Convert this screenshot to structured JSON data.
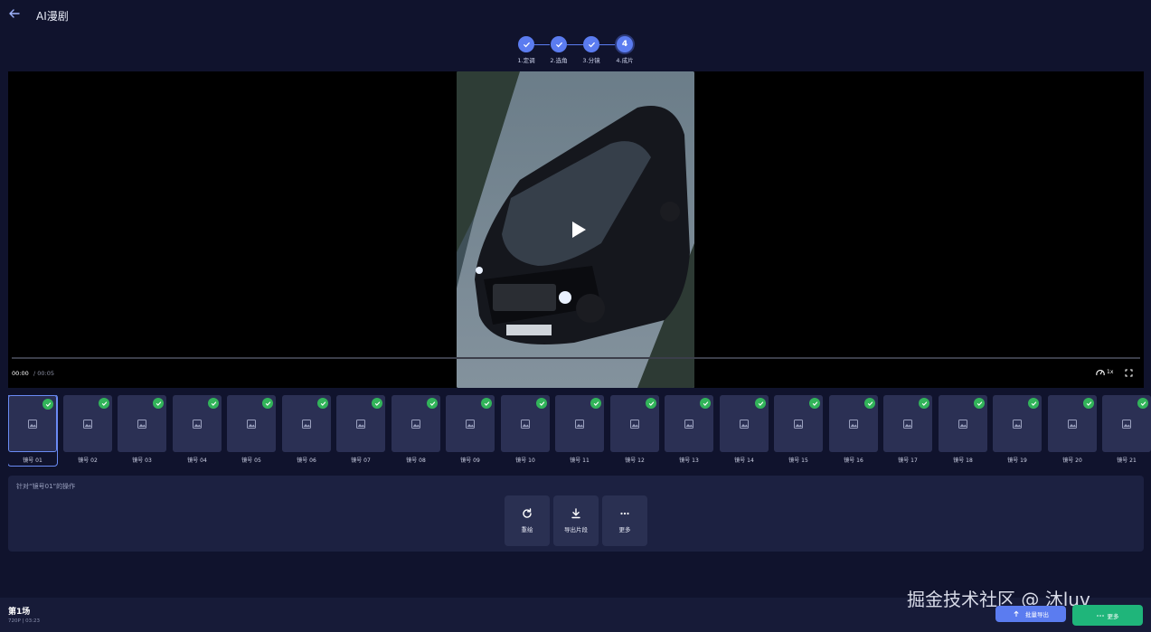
{
  "header": {
    "title": "AI漫剧"
  },
  "stepper": {
    "steps": [
      {
        "label": "1.定调",
        "state": "done"
      },
      {
        "label": "2.选角",
        "state": "done"
      },
      {
        "label": "3.分镜",
        "state": "done"
      },
      {
        "label": "4.成片",
        "state": "current",
        "number": "4"
      }
    ]
  },
  "player": {
    "current_time": "00:00",
    "total_time": "/ 00:05",
    "speed": "1x",
    "progress": 0
  },
  "shots": {
    "selected_index": 0,
    "items": [
      "镜号 01",
      "镜号 02",
      "镜号 03",
      "镜号 04",
      "镜号 05",
      "镜号 06",
      "镜号 07",
      "镜号 08",
      "镜号 09",
      "镜号 10",
      "镜号 11",
      "镜号 12",
      "镜号 13",
      "镜号 14",
      "镜号 15",
      "镜号 16",
      "镜号 17",
      "镜号 18",
      "镜号 19",
      "镜号 20",
      "镜号 21"
    ]
  },
  "ops_panel": {
    "title": "针对“镜号01”的操作",
    "buttons": [
      {
        "label": "重绘",
        "icon": "refresh-icon"
      },
      {
        "label": "导出片段",
        "icon": "download-icon"
      },
      {
        "label": "更多",
        "icon": "more-dots-icon"
      }
    ]
  },
  "footer": {
    "scene_title": "第1场",
    "scene_meta": "720P | 03:23",
    "batch_export_label": "批量导出",
    "more_label": "更多",
    "watermark": "掘金技术社区 @ 沐luv"
  },
  "colors": {
    "accent": "#5b7cf0",
    "success": "#32b45a",
    "more_button": "#1fb57a",
    "background": "#10132d"
  }
}
